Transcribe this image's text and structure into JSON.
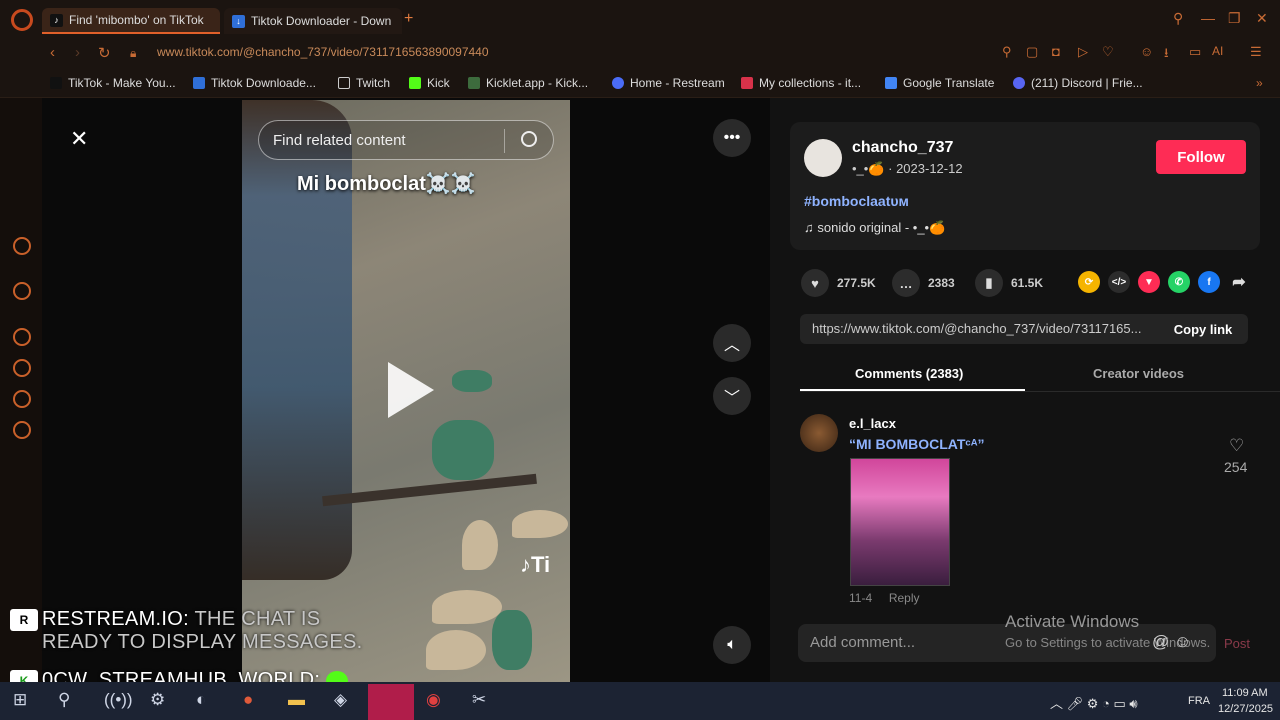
{
  "browser": {
    "tabs": [
      {
        "label": "Find 'mibombo' on TikTok",
        "active": true
      },
      {
        "label": "Tiktok Downloader - Down",
        "active": false
      }
    ],
    "url": "www.tiktok.com/@chancho_737/video/7311716563890097440",
    "toolbar_ai": "AI",
    "bookmarks": [
      "TikTok - Make You...",
      "Tiktok Downloade...",
      "Twitch",
      "Kick",
      "Kicklet.app - Kick...",
      "Home - Restream",
      "My collections - it...",
      "Google Translate",
      "(211) Discord | Frie..."
    ]
  },
  "video": {
    "search_placeholder": "Find related content",
    "caption": "Mi bomboclat☠️☠️",
    "watermark": "Ti"
  },
  "post": {
    "username": "chancho_737",
    "subtitle": "•_•🍊 · 2023-12-12",
    "follow_label": "Follow",
    "hashtag": "#bomboclaatᴜᴍ",
    "sound": "sonido original - •_•🍊",
    "likes": "277.5K",
    "comments": "2383",
    "saves": "61.5K",
    "link": "https://www.tiktok.com/@chancho_737/video/73117165...",
    "copy_label": "Copy link"
  },
  "comments_tabs": {
    "comments": "Comments (2383)",
    "creator": "Creator videos"
  },
  "comment": {
    "user": "e.l_lacx",
    "text": "“MI BOMBOCLATᶜᴬ”",
    "date": "11-4",
    "reply": "Reply",
    "likes": "254"
  },
  "composer": {
    "placeholder": "Add comment...",
    "post_label": "Post"
  },
  "windows_watermark": {
    "line1": "Activate Windows",
    "line2": "Go to Settings to activate Windows."
  },
  "stream_overlay": {
    "line1_user": "RESTREAM.IO:",
    "line1_msg": "THE CHAT IS",
    "line1_msg2": "READY TO DISPLAY MESSAGES.",
    "line2_user": "0CW_STREAMHUB_WORLD:"
  },
  "taskbar": {
    "lang": "FRA",
    "time": "11:09 AM",
    "date": "12/27/2025"
  },
  "colors": {
    "follow": "#fe2c55",
    "opera_accent": "#c84a1e",
    "link_blue": "#8fb3ff"
  }
}
